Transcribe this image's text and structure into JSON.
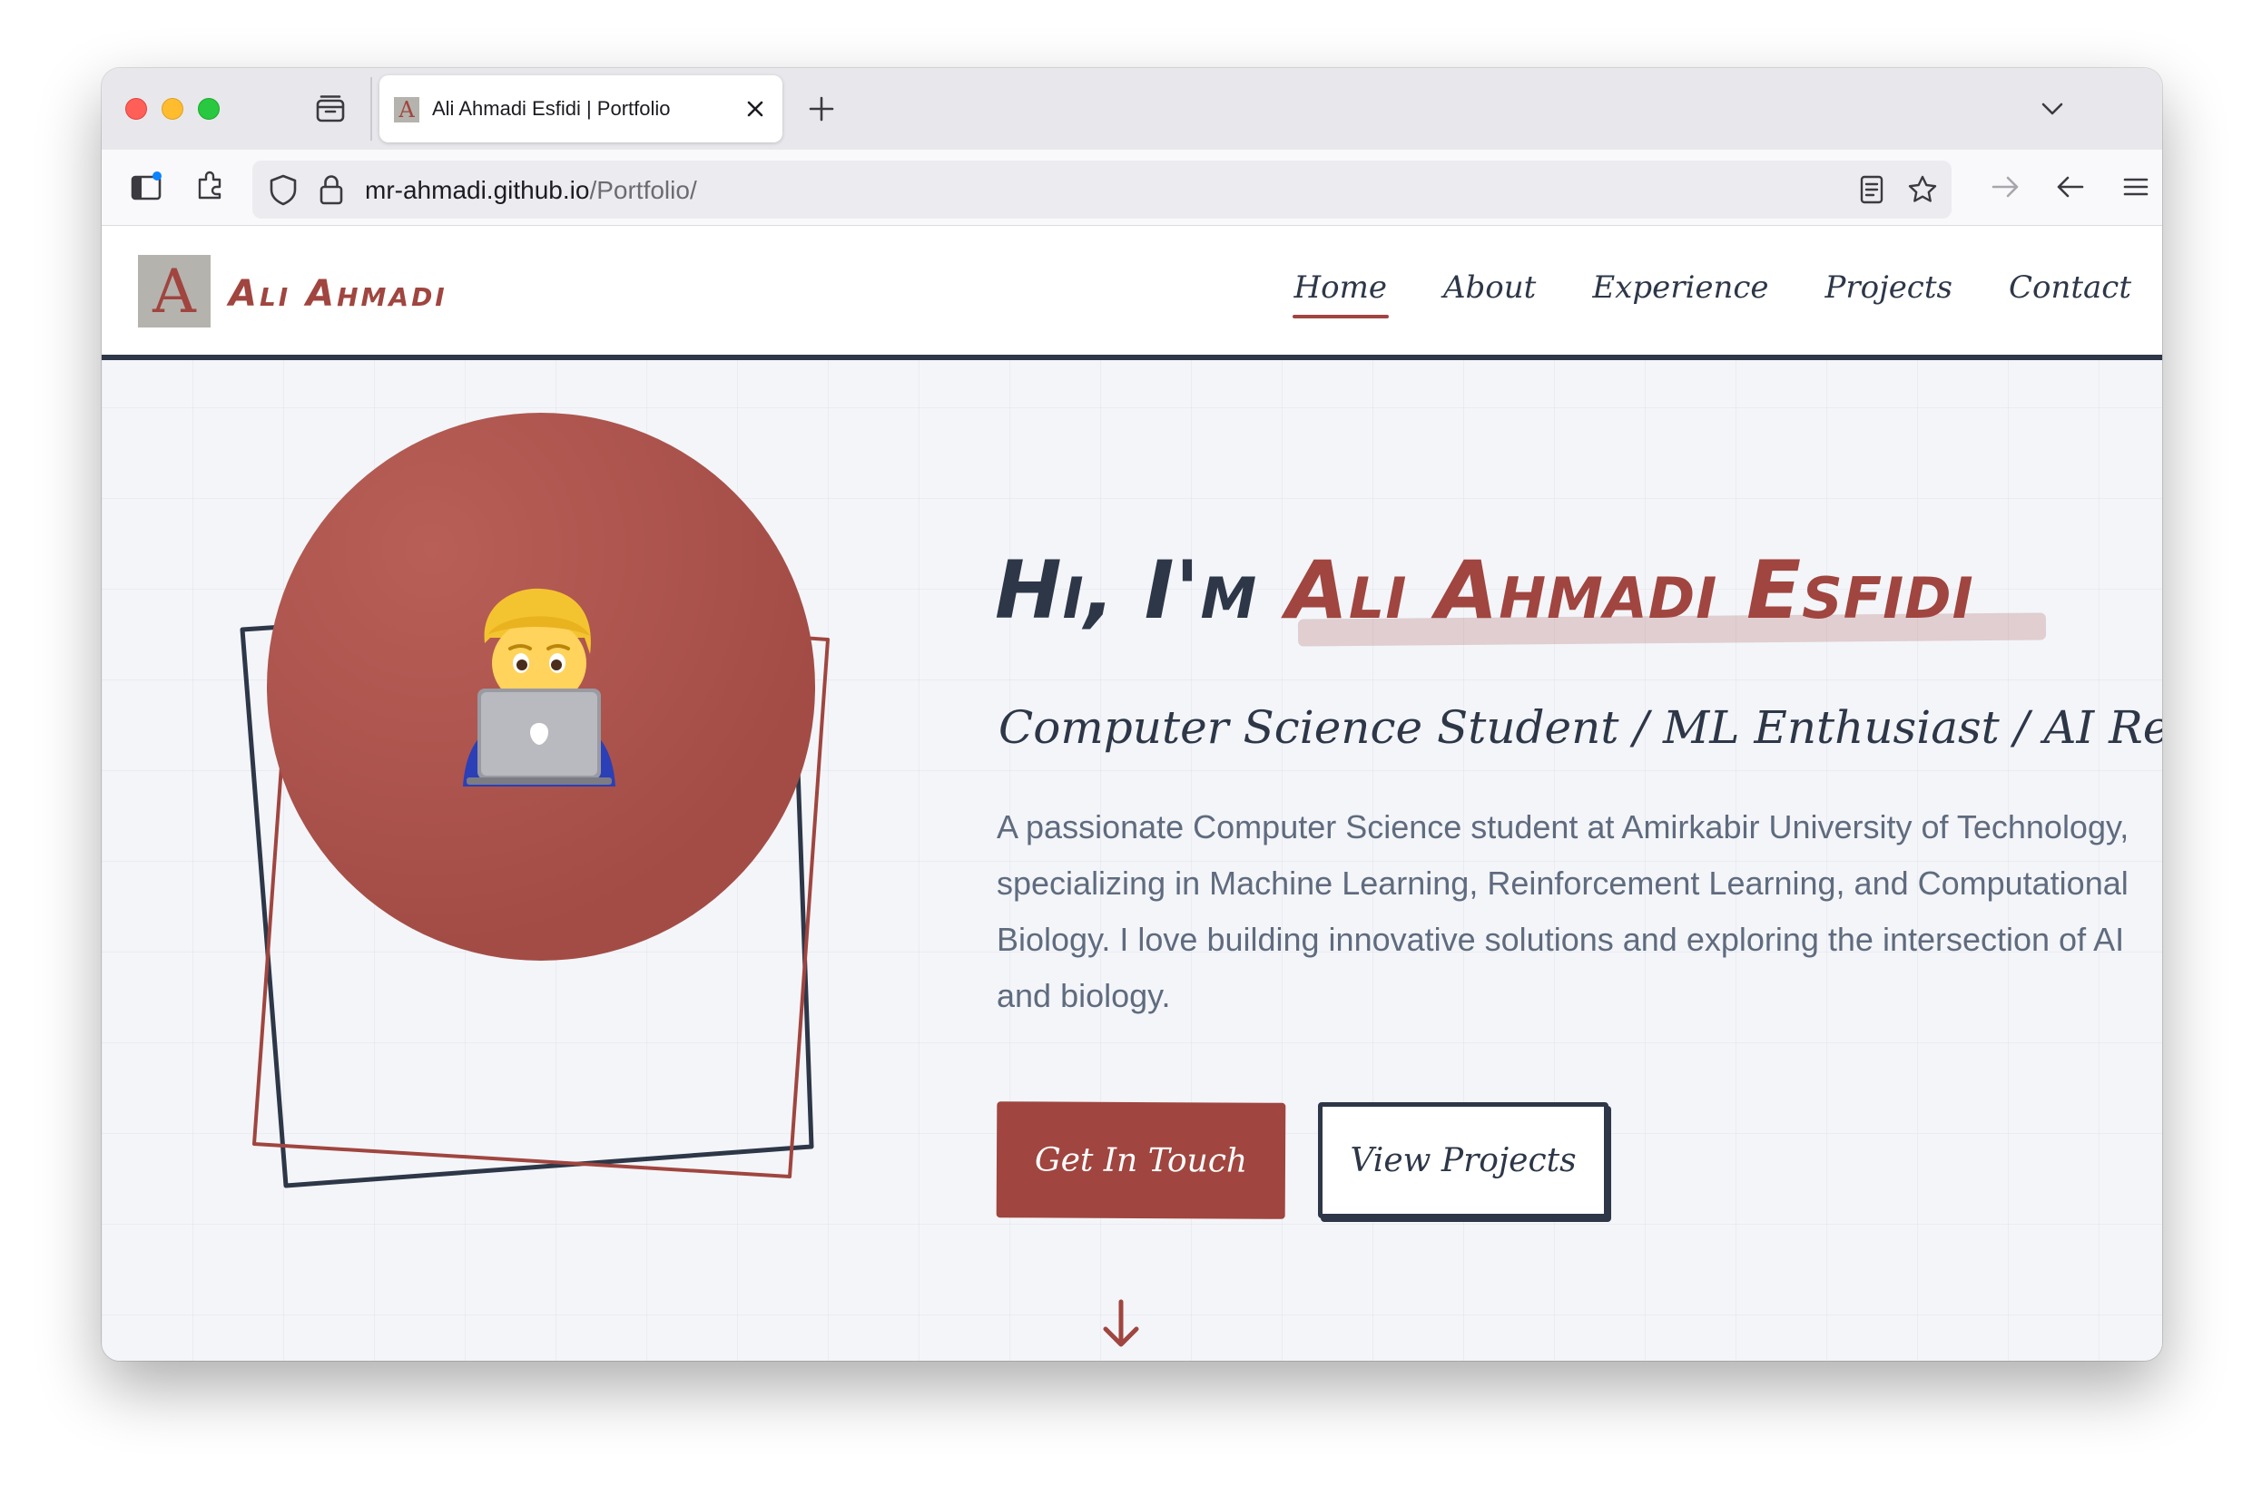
{
  "browser": {
    "tab_title": "Ali Ahmadi Esfidi | Portfolio",
    "tab_favicon_letter": "A",
    "url_host": "mr-ahmadi.github.io",
    "url_path": "/Portfolio/"
  },
  "site": {
    "logo_letter": "A",
    "logo_text": "Ali Ahmadi",
    "nav": [
      {
        "label": "Home",
        "active": true
      },
      {
        "label": "About",
        "active": false
      },
      {
        "label": "Experience",
        "active": false
      },
      {
        "label": "Projects",
        "active": false
      },
      {
        "label": "Contact",
        "active": false
      }
    ]
  },
  "hero": {
    "greeting_prefix": "Hi, I'm ",
    "name": "Ali Ahmadi Esfidi",
    "subtitle": "Computer Science Student / ML Enthusiast / AI Researcher",
    "description": "A passionate Computer Science student at Amirkabir University of Technology, specializing in Machine Learning, Reinforcement Learning, and Computational Biology. I love building innovative solutions and exploring the intersection of AI and biology.",
    "primary_button": "Get In Touch",
    "secondary_button": "View Projects",
    "avatar_icon": "man-technologist-icon"
  },
  "colors": {
    "accent": "#a0453f",
    "dark": "#2d3748",
    "muted_text": "#5f6b7e",
    "background": "#f3f5f9"
  }
}
